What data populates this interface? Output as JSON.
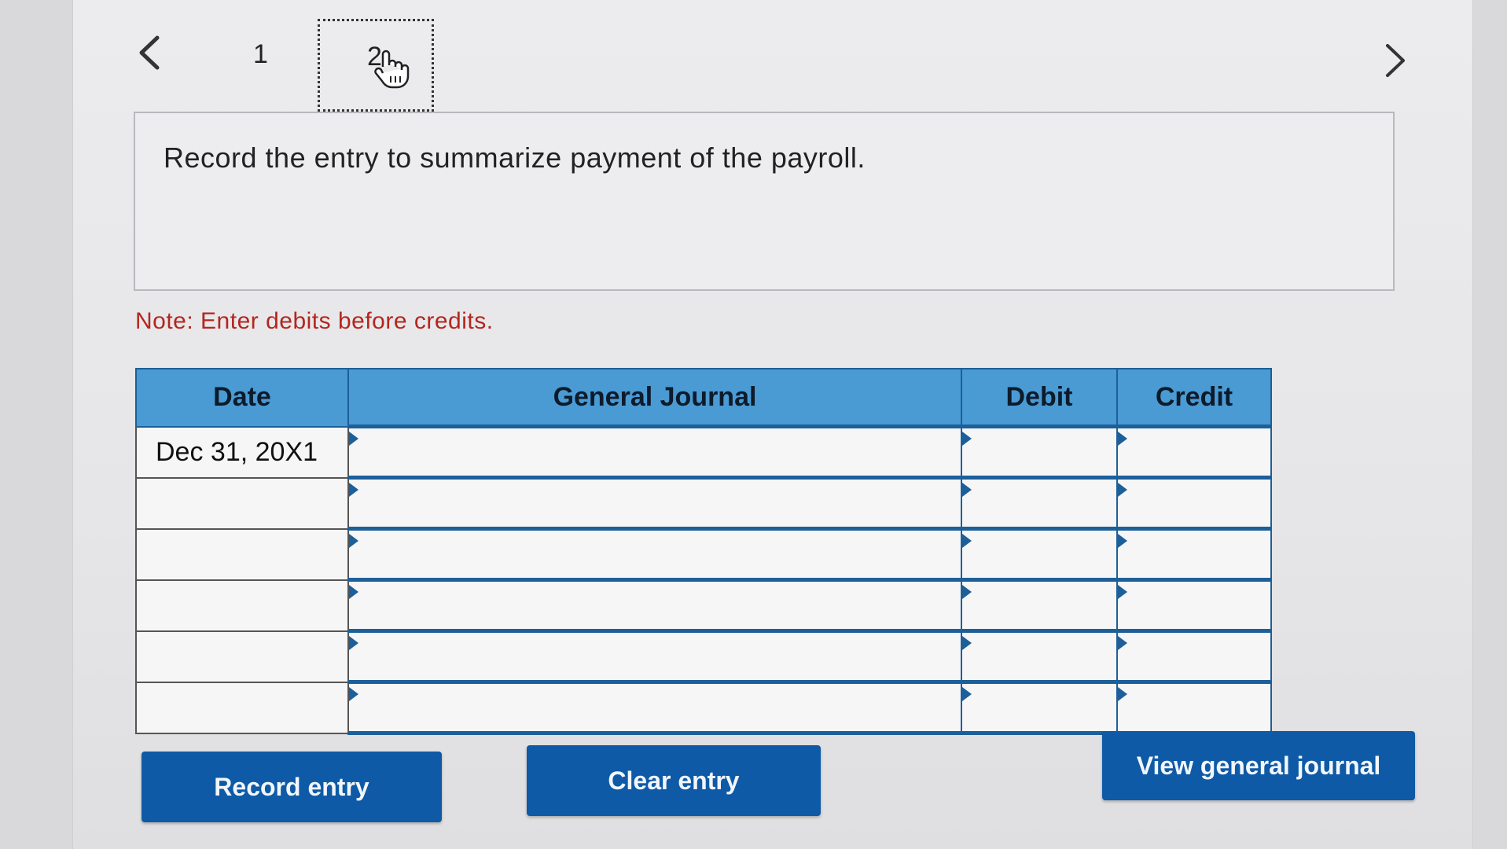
{
  "pagination": {
    "pages": [
      "1",
      "2"
    ],
    "current_page": "2"
  },
  "icons": {
    "prev": "chevron-left-icon",
    "next": "chevron-right-icon",
    "cursor": "hand-pointer-icon"
  },
  "question": {
    "text": "Record the entry to summarize payment of the payroll."
  },
  "note": "Note: Enter debits before credits.",
  "journal": {
    "headers": {
      "date": "Date",
      "general_journal": "General Journal",
      "debit": "Debit",
      "credit": "Credit"
    },
    "rows": [
      {
        "date": "Dec 31, 20X1",
        "account": "",
        "debit": "",
        "credit": ""
      },
      {
        "date": "",
        "account": "",
        "debit": "",
        "credit": ""
      },
      {
        "date": "",
        "account": "",
        "debit": "",
        "credit": ""
      },
      {
        "date": "",
        "account": "",
        "debit": "",
        "credit": ""
      },
      {
        "date": "",
        "account": "",
        "debit": "",
        "credit": ""
      },
      {
        "date": "",
        "account": "",
        "debit": "",
        "credit": ""
      }
    ]
  },
  "buttons": {
    "record": "Record entry",
    "clear": "Clear entry",
    "view": "View general journal"
  },
  "colors": {
    "header_bg": "#4a9ad4",
    "button_bg": "#0e5aa7",
    "note_text": "#b3261e",
    "grid_line": "#1d5f99"
  }
}
